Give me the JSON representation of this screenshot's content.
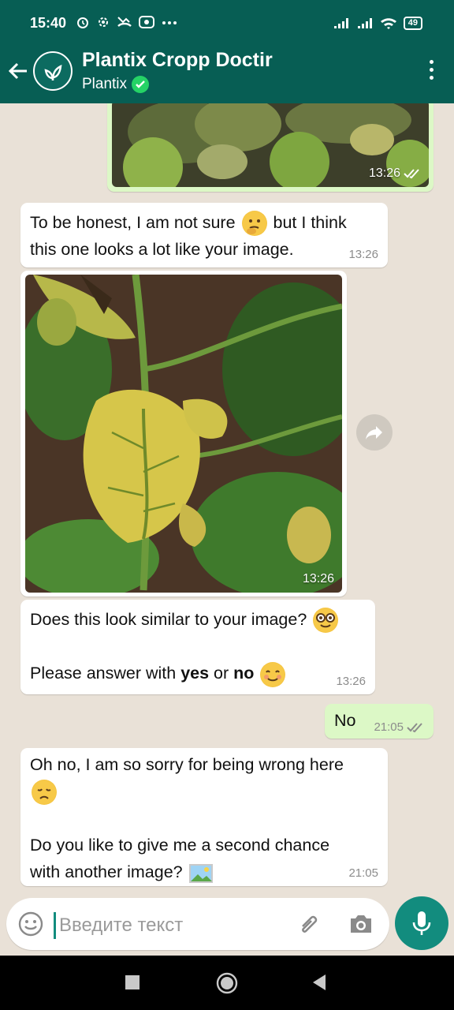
{
  "status_bar": {
    "time": "15:40",
    "battery": "49",
    "icons": [
      "alarm-icon",
      "settings-icon",
      "missed-call-icon",
      "cast-icon",
      "more-icon"
    ]
  },
  "header": {
    "title": "Plantix Cropp Doctir",
    "subtitle": "Plantix",
    "verified": true
  },
  "messages": [
    {
      "type": "image",
      "direction": "out",
      "time": "13:26",
      "read": true
    },
    {
      "type": "text",
      "direction": "in",
      "lines": [
        "To be honest, I am not sure",
        "but I think",
        "this one looks a lot like your image."
      ],
      "emoji": "thinking-face",
      "time": "13:26"
    },
    {
      "type": "image",
      "direction": "in",
      "time": "13:26"
    },
    {
      "type": "text",
      "direction": "in",
      "line1": "Does this look similar to your image?",
      "emoji1": "nerd-face",
      "line2_prefix": "Please answer with ",
      "bold_yes": "yes",
      "or_text": " or ",
      "bold_no": "no",
      "emoji2": "smiling-face",
      "time": "13:26"
    },
    {
      "type": "text",
      "direction": "out",
      "text": "No",
      "time": "21:05",
      "read": true
    },
    {
      "type": "text",
      "direction": "in",
      "line1": "Oh no, I am so sorry for being wrong here",
      "emoji1": "disappointed-face",
      "line2": "Do you like to give me a second chance",
      "line3": "with another image?",
      "emoji2": "picture-icon",
      "time": "21:05"
    }
  ],
  "composer": {
    "placeholder": "Введите текст"
  },
  "colors": {
    "header": "#075e54",
    "accent": "#128c7e",
    "outgoing": "#dcf8c6",
    "chat_bg": "#e9e1d7"
  }
}
